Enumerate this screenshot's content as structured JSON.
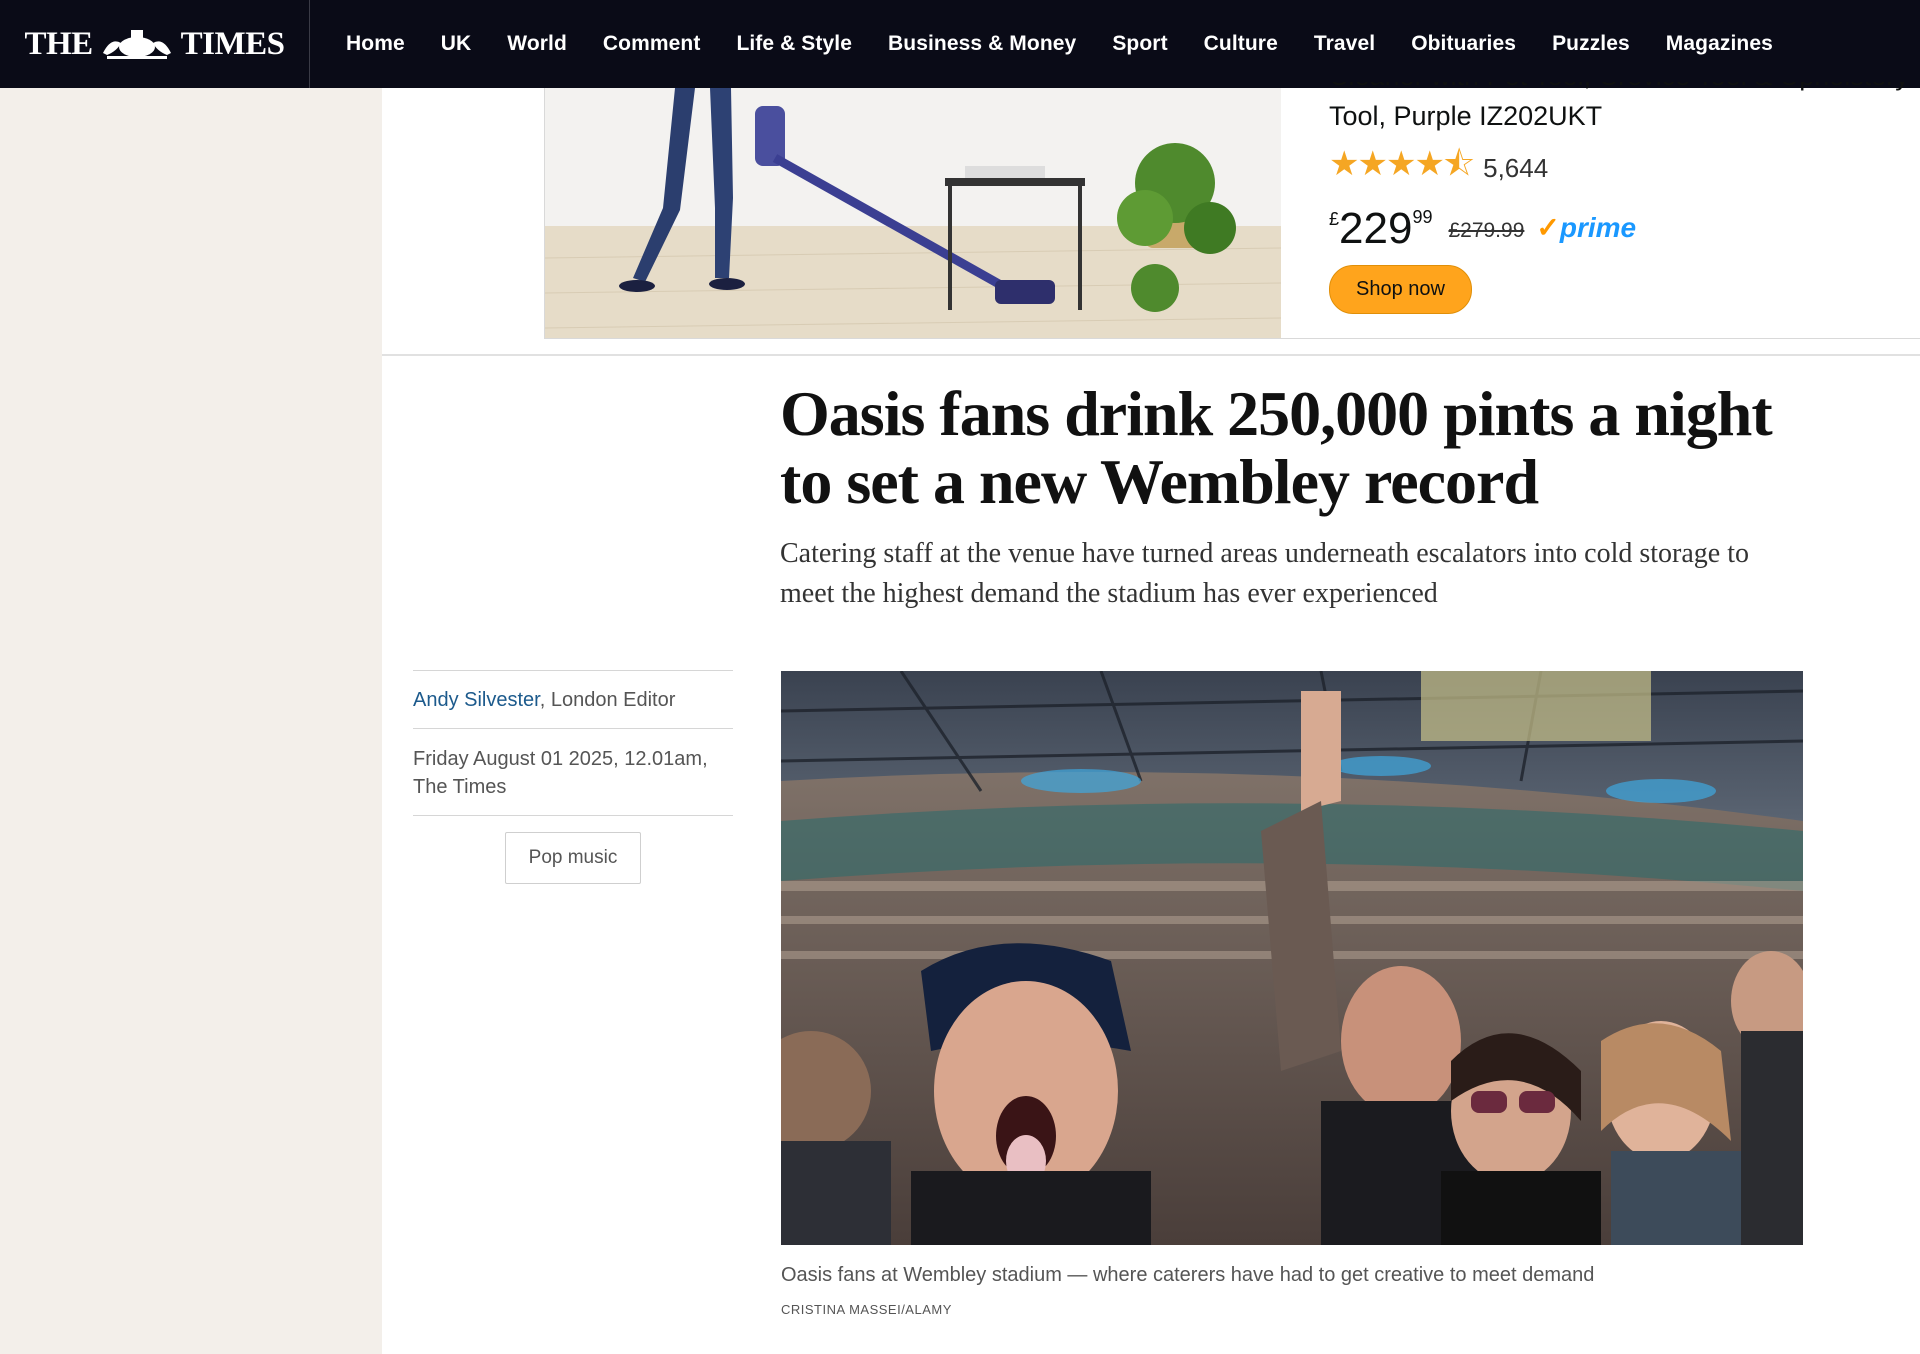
{
  "site": {
    "logo_text_left": "THE",
    "logo_text_right": "TIMES"
  },
  "nav": {
    "items": [
      "Home",
      "UK",
      "World",
      "Comment",
      "Life & Style",
      "Business & Money",
      "Sport",
      "Culture",
      "Travel",
      "Obituaries",
      "Puzzles",
      "Magazines"
    ]
  },
  "ad": {
    "title_line1": "Cleaner with Pet Tool, Crevice Tool & Upholstery",
    "title_line2": "Tool, Purple IZ202UKT",
    "stars": "★★★★⯪",
    "rating_count": "5,644",
    "currency": "£",
    "price_main": "229",
    "price_fraction": "99",
    "price_old": "£279.99",
    "prime_label": "prime",
    "shop_label": "Shop now"
  },
  "article": {
    "headline": "Oasis fans drink 250,000 pints a night to set a new Wembley record",
    "standfirst": "Catering staff at the venue have turned areas underneath escalators into cold storage to meet the highest demand the stadium has ever experienced",
    "author_name": "Andy Silvester",
    "author_role": ", London Editor",
    "date_line1": "Friday August 01 2025, 12.01am,",
    "date_line2": "The Times",
    "tag": "Pop music",
    "caption": "Oasis fans at Wembley stadium — where caterers have had to get creative to meet demand",
    "credit": "CRISTINA MASSEI/ALAMY"
  }
}
